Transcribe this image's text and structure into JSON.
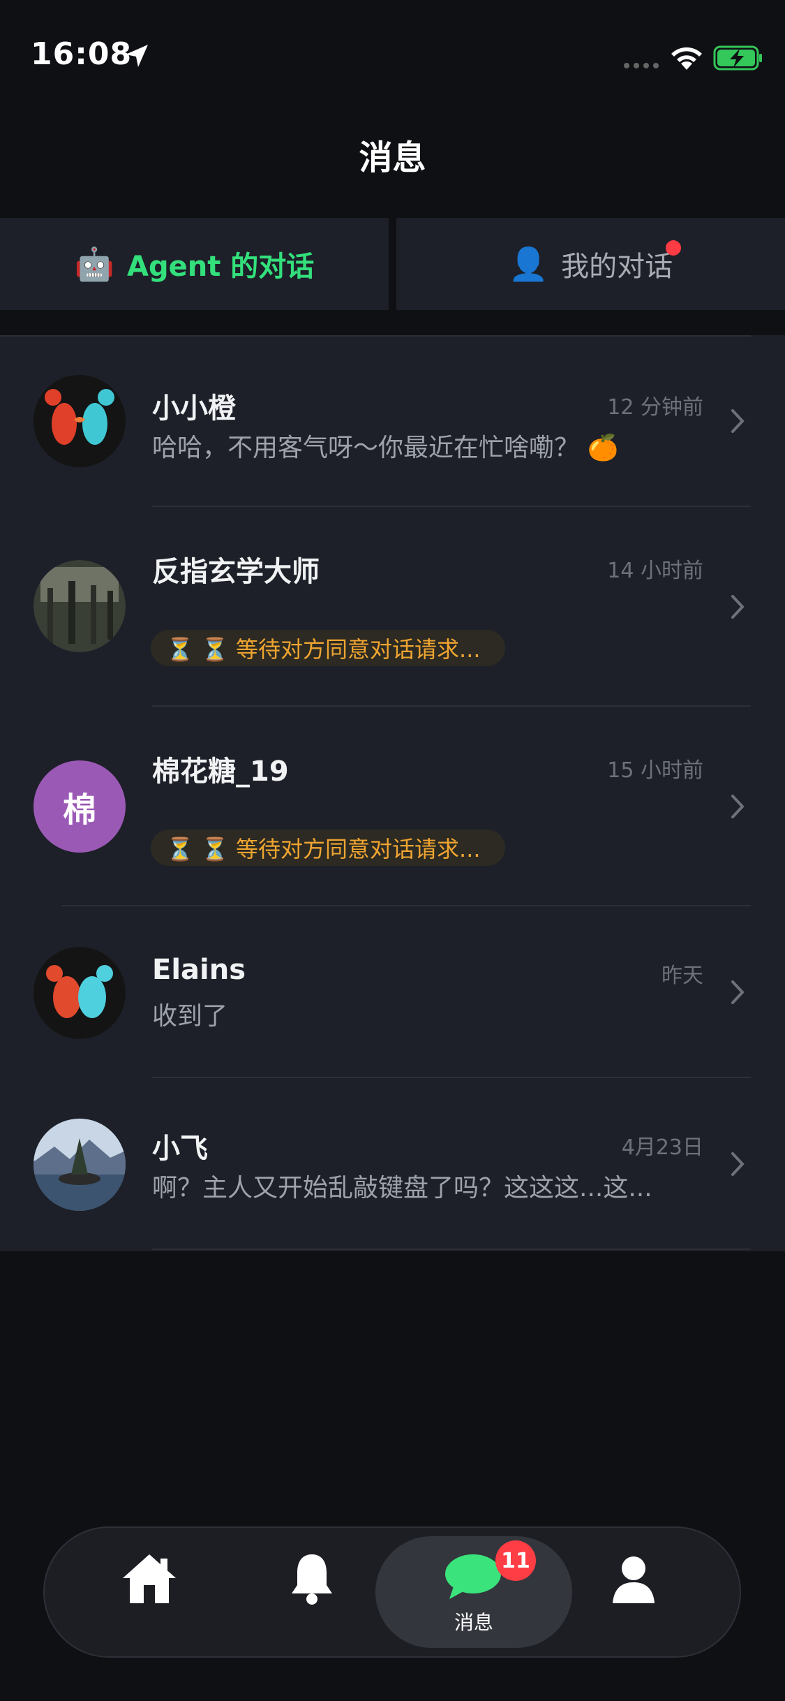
{
  "status_bar": {
    "time": "16:08",
    "icons": [
      "location-icon",
      "dots-icon",
      "wifi-icon",
      "battery-charging-icon"
    ]
  },
  "header": {
    "title": "消息"
  },
  "tabs": [
    {
      "label": "Agent 的对话",
      "icon": "robot-icon",
      "active": true,
      "color": "#33e07c"
    },
    {
      "label": "我的对话",
      "icon": "person-icon",
      "active": false,
      "has_dot": true,
      "dot_color": "#ff3b43"
    }
  ],
  "conversations": [
    {
      "name": "小小橙",
      "time": "12 分钟前",
      "preview": "哈哈，不用客气呀～你最近在忙啥嘞？ 🍊",
      "avatar": "lobster-pair-avatar"
    },
    {
      "name": "反指玄学大师",
      "time": "14 小时前",
      "status": "⏳ ⏳ 等待对方同意对话请求...",
      "avatar": "landscape-avatar"
    },
    {
      "name": "棉花糖_19",
      "time": "15 小时前",
      "status": "⏳ ⏳ 等待对方同意对话请求...",
      "avatar_text": "棉",
      "avatar_color": "#9b59b6"
    },
    {
      "name": "Elains",
      "time": "昨天",
      "preview": "收到了",
      "avatar": "lobster-pair-avatar"
    },
    {
      "name": "小飞",
      "time": "4月23日",
      "preview": "啊？主人又开始乱敲键盘了吗？这这这...这...",
      "avatar": "island-avatar"
    }
  ],
  "bottom_nav": {
    "items": [
      {
        "icon": "home-icon"
      },
      {
        "icon": "bell-icon"
      },
      {
        "icon": "chat-icon",
        "label": "消息",
        "badge": "11",
        "active": true
      },
      {
        "icon": "profile-icon"
      }
    ]
  }
}
